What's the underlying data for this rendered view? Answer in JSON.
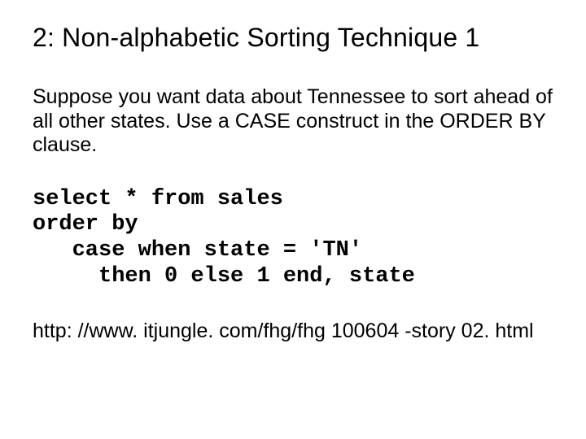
{
  "slide": {
    "title": "2: Non-alphabetic Sorting Technique 1",
    "body": "Suppose you want data about Tennessee to sort ahead of all other states. Use a CASE construct in the ORDER BY clause.",
    "code": "select * from sales\norder by\n   case when state = 'TN'\n     then 0 else 1 end, state",
    "link": "http: //www. itjungle. com/fhg/fhg 100604 -story 02. html"
  }
}
